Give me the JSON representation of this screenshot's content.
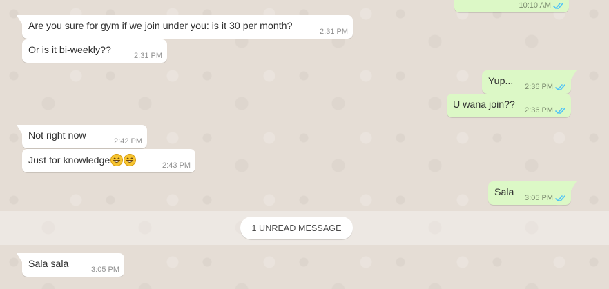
{
  "theme": {
    "wallpaper": "#e5ddd5",
    "incoming_bubble": "#ffffff",
    "outgoing_bubble": "#dcf8c6",
    "read_tick": "#4fc3f7",
    "timestamp": "#8a8a8a"
  },
  "top_partial_message": {
    "time": "10:10 AM",
    "status": "read"
  },
  "messages": [
    {
      "direction": "incoming",
      "text": "Are you sure for gym if we join under you: is it 30 per month?",
      "time": "2:31 PM"
    },
    {
      "direction": "incoming",
      "text": "Or is it bi-weekly??",
      "time": "2:31 PM"
    },
    {
      "direction": "outgoing",
      "text": "Yup...",
      "time": "2:36 PM",
      "status": "read"
    },
    {
      "direction": "outgoing",
      "text": "U wana join??",
      "time": "2:36 PM",
      "status": "read"
    },
    {
      "direction": "incoming",
      "text": "Not right now",
      "time": "2:42 PM"
    },
    {
      "direction": "incoming",
      "text": "Just for knowledge",
      "emojis": [
        "grinning-face-with-smiling-eyes",
        "grinning-face-with-smiling-eyes"
      ],
      "time": "2:43 PM"
    },
    {
      "direction": "outgoing",
      "text": "Sala",
      "time": "3:05 PM",
      "status": "read"
    },
    {
      "direction": "incoming",
      "text": "Sala sala",
      "time": "3:05 PM"
    }
  ],
  "unread_divider": {
    "label": "1 UNREAD MESSAGE"
  }
}
